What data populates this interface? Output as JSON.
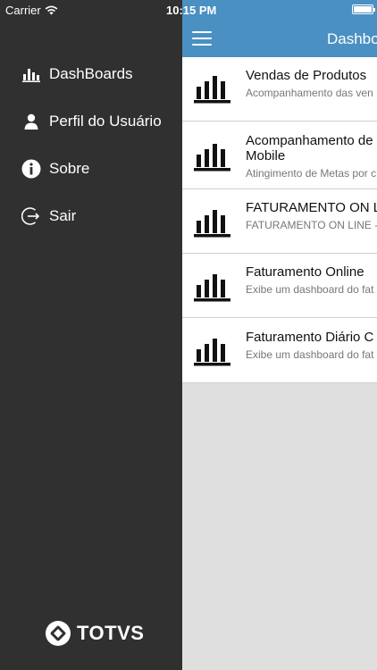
{
  "status_bar": {
    "carrier": "Carrier",
    "time": "10:15 PM"
  },
  "menu": {
    "items": [
      {
        "label": "DashBoards",
        "icon": "bar-chart-icon"
      },
      {
        "label": "Perfil do Usuário",
        "icon": "user-icon"
      },
      {
        "label": "Sobre",
        "icon": "info-icon"
      },
      {
        "label": "Sair",
        "icon": "logout-icon"
      }
    ],
    "brand": "TOTVS"
  },
  "header": {
    "title": "Dashbo"
  },
  "list": {
    "items": [
      {
        "title": "Vendas de Produtos",
        "title2": "",
        "subtitle": "Acompanhamento das ven"
      },
      {
        "title": "Acompanhamento de",
        "title2": "Mobile",
        "subtitle": "Atingimento de Metas por c"
      },
      {
        "title": "FATURAMENTO ON L",
        "title2": "",
        "subtitle": "FATURAMENTO ON LINE -"
      },
      {
        "title": "Faturamento Online",
        "title2": "",
        "subtitle": "Exibe um dashboard do fat"
      },
      {
        "title": "Faturamento Diário C",
        "title2": "",
        "subtitle": "Exibe um dashboard do fat"
      }
    ]
  },
  "colors": {
    "navbar": "#4a90c2",
    "drawer": "#303030",
    "content_bg": "#dfdfdf"
  }
}
